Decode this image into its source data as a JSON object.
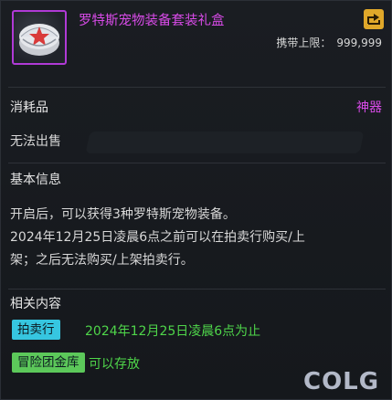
{
  "item": {
    "title": "罗特斯宠物装备套装礼盒",
    "carry_label": "携带上限：",
    "carry_value": "999,999"
  },
  "type": {
    "label": "消耗品",
    "grade": "神器"
  },
  "trade_status": "无法出售",
  "basic_info": {
    "heading": "基本信息",
    "lines": [
      "开启后，可以获得3种罗特斯宠物装备。",
      "2024年12月25日凌晨6点之前可以在拍卖行购买/上",
      "架；之后无法购买/上架拍卖行。"
    ]
  },
  "related": {
    "heading": "相关内容",
    "auction": {
      "label": "拍卖行",
      "text": "2024年12月25日凌晨6点为止",
      "color": "#36c6e0"
    },
    "guild_bank": {
      "label": "冒险团金库",
      "text": "可以存放",
      "color": "#5cc85a"
    }
  },
  "colors": {
    "title": "#d84be8",
    "grade": "#d84be8",
    "green_text": "#4fd64a"
  },
  "icons": {
    "item": "pet-gift-box-icon",
    "share": "share-arrow-icon"
  },
  "watermark": "COLG"
}
